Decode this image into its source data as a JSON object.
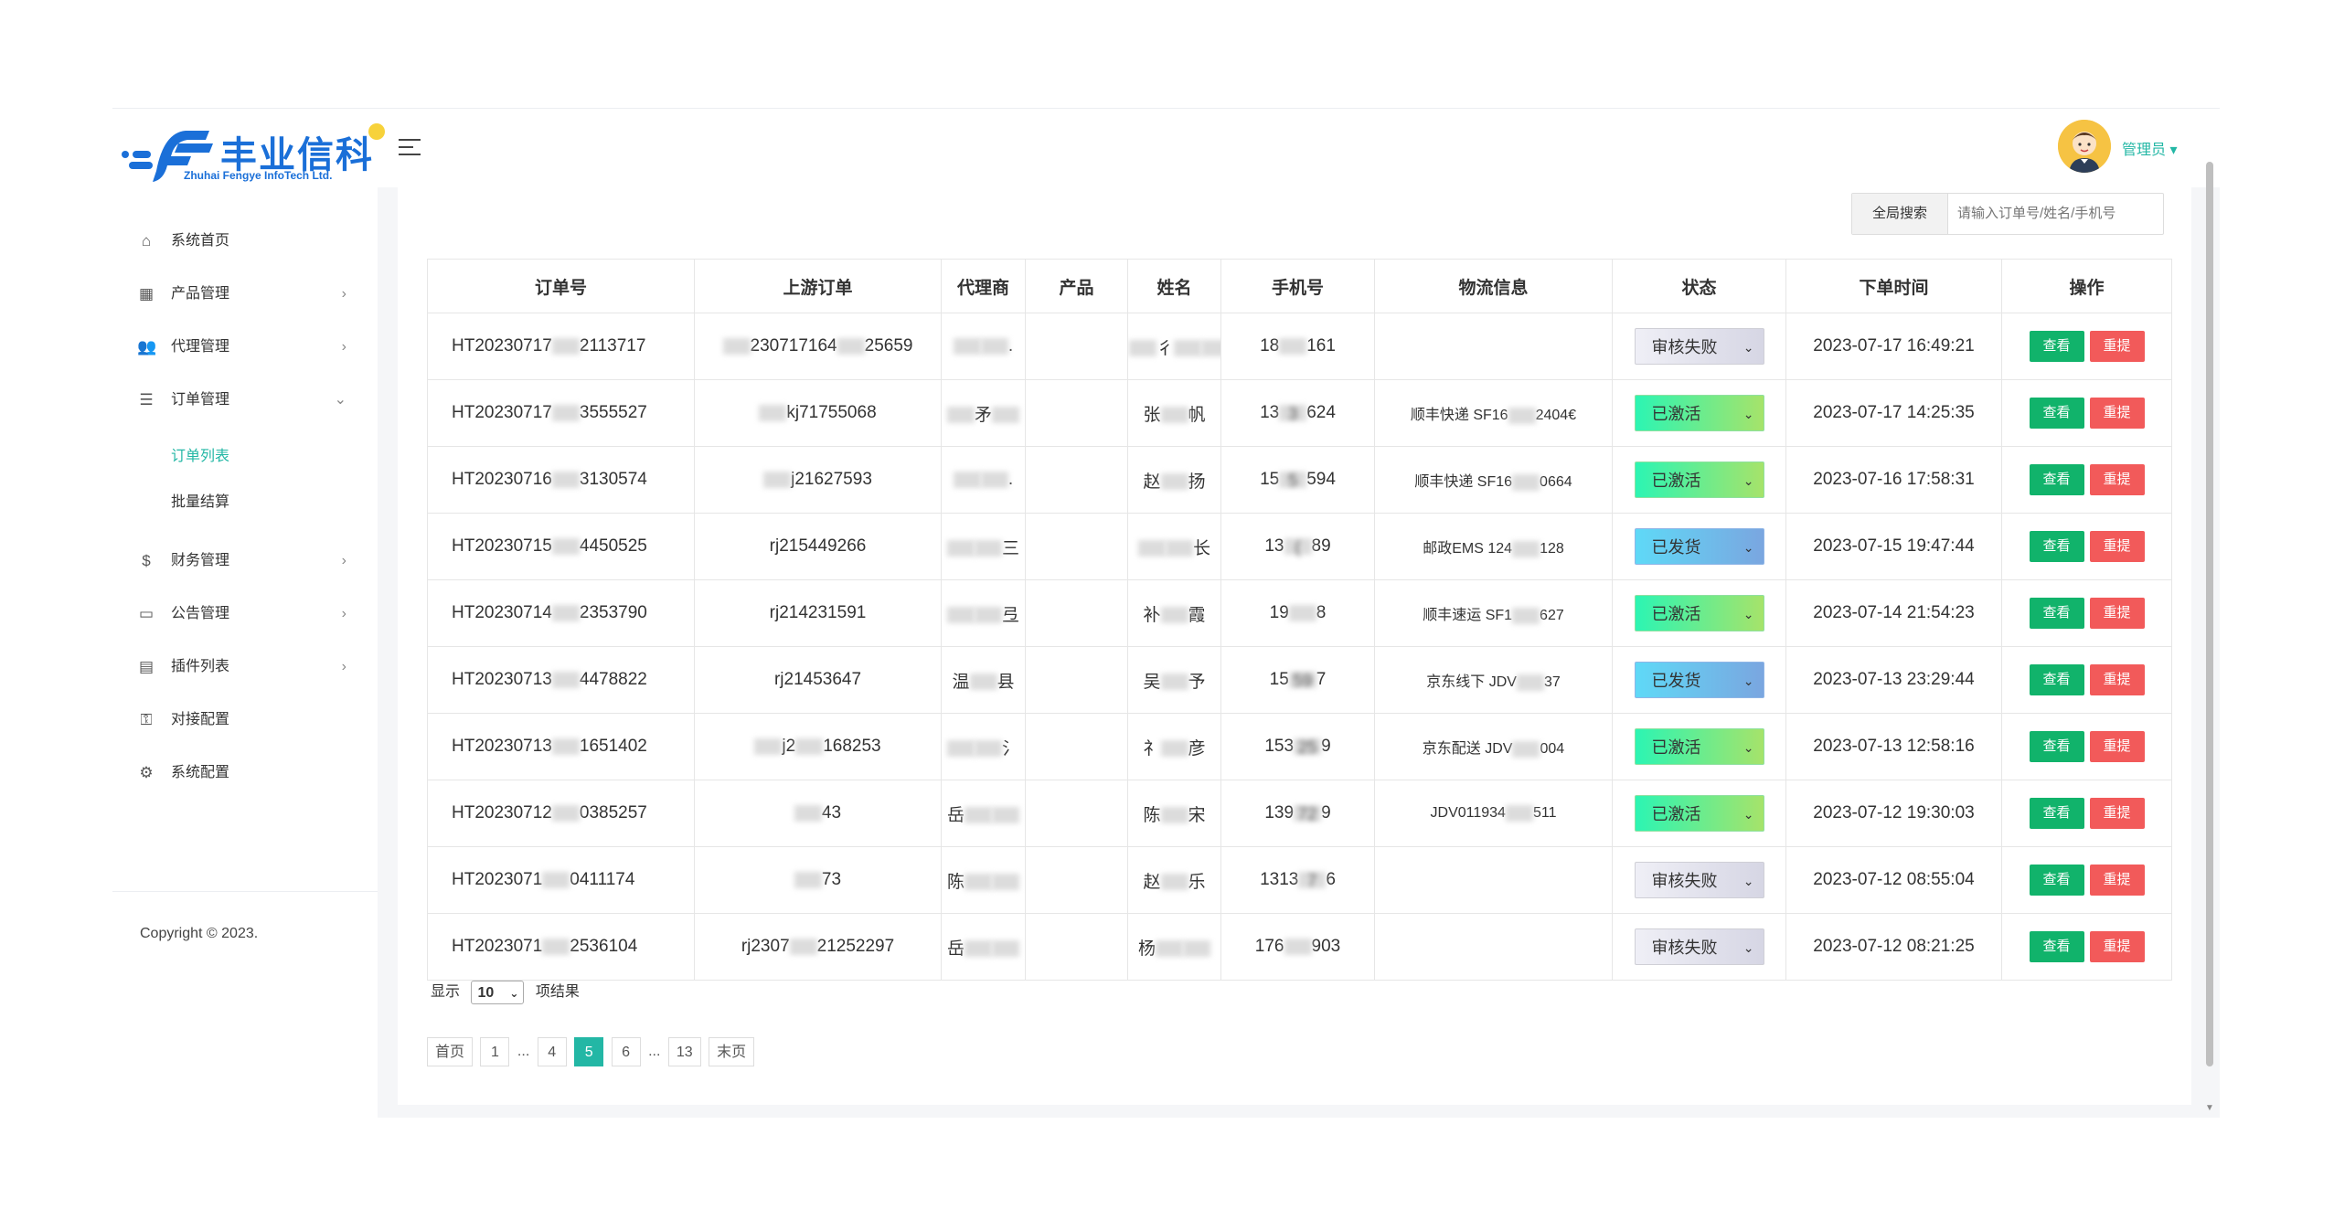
{
  "brand": {
    "logo_text": "丰业信科",
    "logo_sub": "Zhuhai Fengye InfoTech Ltd."
  },
  "header": {
    "user_name": "管理员 ▾"
  },
  "sidebar": {
    "items": [
      {
        "label": "系统首页",
        "icon": "home-icon",
        "arrow": ""
      },
      {
        "label": "产品管理",
        "icon": "grid-icon",
        "arrow": "›"
      },
      {
        "label": "代理管理",
        "icon": "users-icon",
        "arrow": "›"
      },
      {
        "label": "订单管理",
        "icon": "list-icon",
        "arrow": "⌄"
      }
    ],
    "sub_items": [
      {
        "label": "订单列表"
      },
      {
        "label": "批量结算"
      }
    ],
    "items_after": [
      {
        "label": "财务管理",
        "icon": "dollar-icon",
        "arrow": "›"
      },
      {
        "label": "公告管理",
        "icon": "announcement-icon",
        "arrow": "›"
      },
      {
        "label": "插件列表",
        "icon": "plugin-icon",
        "arrow": "›"
      },
      {
        "label": "对接配置",
        "icon": "key-icon",
        "arrow": ""
      },
      {
        "label": "系统配置",
        "icon": "settings-icon",
        "arrow": ""
      }
    ],
    "copyright": "Copyright © 2023."
  },
  "search": {
    "label": "全局搜索",
    "placeholder": "请输入订单号/姓名/手机号"
  },
  "table": {
    "headers": [
      "订单号",
      "上游订单",
      "代理商",
      "产品",
      "姓名",
      "手机号",
      "物流信息",
      "状态",
      "下单时间",
      "操作"
    ],
    "rows": [
      {
        "order": [
          "HT20230717",
          "",
          "2113717"
        ],
        "upstream": [
          "",
          "230717164",
          "",
          "25659"
        ],
        "agent": [
          "",
          "",
          "."
        ],
        "name": [
          "",
          "彳",
          "",
          "",
          ""
        ],
        "phone": [
          "18",
          "",
          "161"
        ],
        "logistics": [
          "",
          ""
        ],
        "status": "审核失败",
        "status_type": "fail",
        "time": "2023-07-17 16:49:21"
      },
      {
        "order": [
          "HT20230717",
          "",
          "3555527"
        ],
        "upstream": [
          "",
          "kj",
          "717",
          "55068"
        ],
        "agent": [
          "",
          "矛",
          ""
        ],
        "name": [
          "张",
          "",
          "帆"
        ],
        "phone": [
          "13",
          "3",
          "624"
        ],
        "logistics": [
          "顺丰快递 SF16",
          "2404€"
        ],
        "status": "已激活",
        "status_type": "active",
        "time": "2023-07-17 14:25:35"
      },
      {
        "order": [
          "HT20230716",
          "",
          "3130574"
        ],
        "upstream": [
          "",
          "j2",
          "16",
          "27593"
        ],
        "agent": [
          "",
          "",
          "."
        ],
        "name": [
          "赵",
          "",
          "扬"
        ],
        "phone": [
          "15",
          "5",
          "594"
        ],
        "logistics": [
          "顺丰快递 SF16",
          "0664"
        ],
        "status": "已激活",
        "status_type": "active",
        "time": "2023-07-16 17:58:31"
      },
      {
        "order": [
          "HT20230715",
          "",
          "4450525"
        ],
        "upstream": [
          "r",
          "j2",
          "15",
          "449266"
        ],
        "agent": [
          "",
          "",
          "三"
        ],
        "name": [
          "",
          "",
          "长"
        ],
        "phone": [
          "13",
          "(",
          "89"
        ],
        "logistics": [
          "邮政EMS 124",
          "128"
        ],
        "status": "已发货",
        "status_type": "shipped",
        "time": "2023-07-15 19:47:44"
      },
      {
        "order": [
          "HT20230714",
          "",
          "2353790"
        ],
        "upstream": [
          "r",
          "j2",
          "14",
          "231591"
        ],
        "agent": [
          "",
          "",
          "弖"
        ],
        "name": [
          "补",
          "",
          "霞"
        ],
        "phone": [
          "19",
          "",
          "8"
        ],
        "logistics": [
          "顺丰速运 SF1",
          "627"
        ],
        "status": "已激活",
        "status_type": "active",
        "time": "2023-07-14 21:54:23"
      },
      {
        "order": [
          "HT20230713",
          "",
          "4478822"
        ],
        "upstream": [
          "r",
          "j2",
          "1",
          "453647"
        ],
        "agent": [
          "温",
          "",
          "县"
        ],
        "name": [
          "吴",
          "",
          "予"
        ],
        "phone": [
          "15",
          "59",
          "7"
        ],
        "logistics": [
          "京东线下 JDV",
          "37"
        ],
        "status": "已发货",
        "status_type": "shipped",
        "time": "2023-07-13 23:29:44"
      },
      {
        "order": [
          "HT20230713",
          "",
          "1651402"
        ],
        "upstream": [
          "",
          "j2",
          "",
          "168253"
        ],
        "agent": [
          "",
          "",
          "氵"
        ],
        "name": [
          "礻",
          "",
          "彦"
        ],
        "phone": [
          "153",
          "25",
          "9"
        ],
        "logistics": [
          "京东配送 JDV",
          "004"
        ],
        "status": "已激活",
        "status_type": "active",
        "time": "2023-07-13 12:58:16"
      },
      {
        "order": [
          "HT20230712",
          "",
          "0385257"
        ],
        "upstream": [
          "",
          "",
          "4",
          "3"
        ],
        "agent": [
          "岳",
          "",
          ""
        ],
        "name": [
          "陈",
          "",
          "宋"
        ],
        "phone": [
          "139",
          "72",
          "9"
        ],
        "logistics": [
          "JDV011934",
          "511"
        ],
        "status": "已激活",
        "status_type": "active",
        "time": "2023-07-12 19:30:03"
      },
      {
        "order": [
          "HT2023071",
          "",
          "0411174"
        ],
        "upstream": [
          "",
          "",
          "7",
          "3"
        ],
        "agent": [
          "陈",
          "",
          ""
        ],
        "name": [
          "赵",
          "",
          "乐"
        ],
        "phone": [
          "1313",
          "7",
          "6"
        ],
        "logistics": [
          "",
          ""
        ],
        "status": "审核失败",
        "status_type": "fail",
        "time": "2023-07-12 08:55:04"
      },
      {
        "order": [
          "HT2023071",
          "",
          "2536104"
        ],
        "upstream": [
          "r",
          "j2307",
          "",
          "21252297"
        ],
        "agent": [
          "岳",
          "",
          ""
        ],
        "name": [
          "杨",
          "",
          ""
        ],
        "phone": [
          "176",
          "",
          "903"
        ],
        "logistics": [
          "",
          ""
        ],
        "status": "审核失败",
        "status_type": "fail",
        "time": "2023-07-12 08:21:25"
      }
    ],
    "view_label": "查看",
    "resubmit_label": "重提"
  },
  "page_size": {
    "prefix": "显示",
    "value": "10",
    "suffix": "项结果"
  },
  "pagination": {
    "first": "首页",
    "pages": [
      "1",
      "...",
      "4",
      "5",
      "6",
      "...",
      "13"
    ],
    "current": "5",
    "last": "末页"
  },
  "colors": {
    "accent": "#23b7a5",
    "view_button": "#11b36b",
    "resubmit_button": "#f25a5a"
  }
}
